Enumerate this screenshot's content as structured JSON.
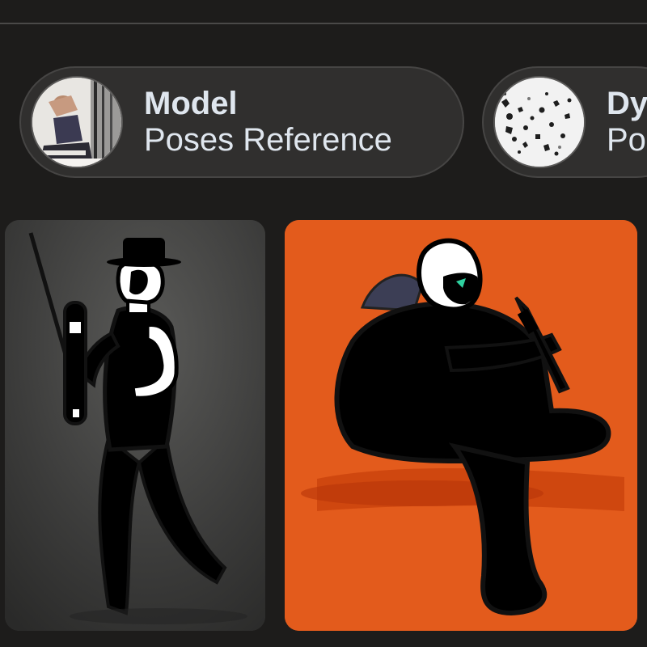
{
  "chips": [
    {
      "title": "Model",
      "subtitle": "Poses Reference",
      "thumbnail_icon": "model-photo-thumbnail"
    },
    {
      "title": "Dy",
      "subtitle": "Po",
      "thumbnail_icon": "ink-splatter-thumbnail"
    }
  ],
  "cards": [
    {
      "image_icon": "standing-figure-with-hat-image",
      "background_color": "#3b3b3a"
    },
    {
      "image_icon": "sitting-figure-orange-image",
      "background_color": "#e35b1c"
    }
  ]
}
